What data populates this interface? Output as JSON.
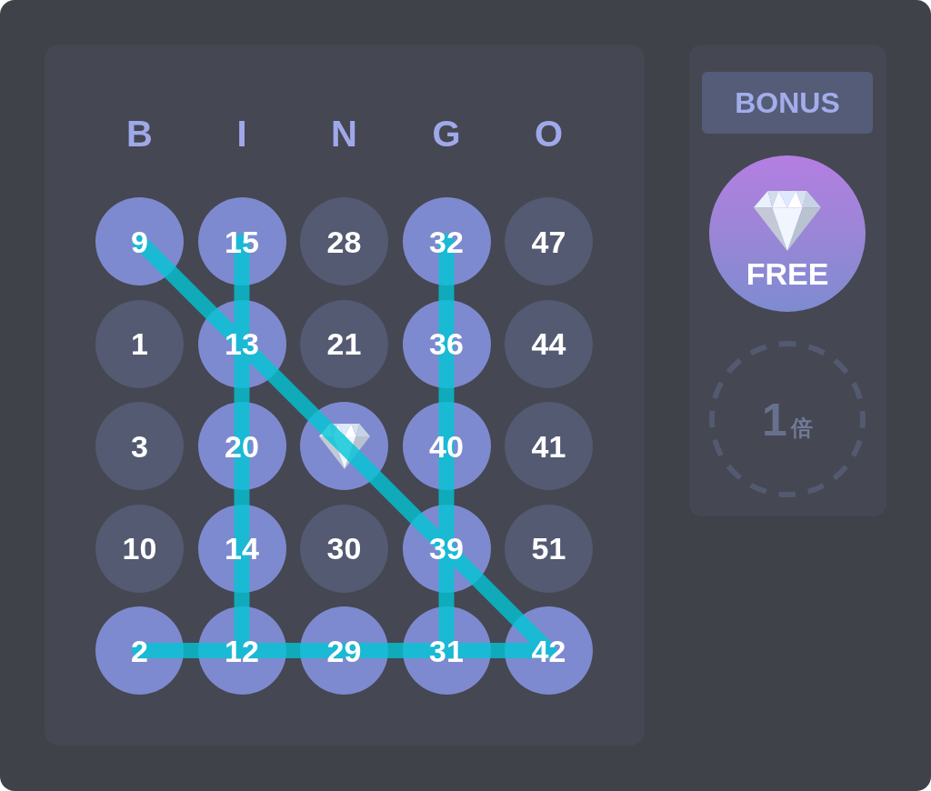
{
  "card": {
    "columns": [
      "B",
      "I",
      "N",
      "G",
      "O"
    ],
    "rows": [
      {
        "cells": [
          {
            "kind": "number",
            "number": "9",
            "marked": true
          },
          {
            "kind": "number",
            "number": "15",
            "marked": true
          },
          {
            "kind": "number",
            "number": "28",
            "marked": false
          },
          {
            "kind": "number",
            "number": "32",
            "marked": true
          },
          {
            "kind": "number",
            "number": "47",
            "marked": false
          }
        ]
      },
      {
        "cells": [
          {
            "kind": "number",
            "number": "1",
            "marked": false
          },
          {
            "kind": "number",
            "number": "13",
            "marked": true
          },
          {
            "kind": "number",
            "number": "21",
            "marked": false
          },
          {
            "kind": "number",
            "number": "36",
            "marked": true
          },
          {
            "kind": "number",
            "number": "44",
            "marked": false
          }
        ]
      },
      {
        "cells": [
          {
            "kind": "number",
            "number": "3",
            "marked": false
          },
          {
            "kind": "number",
            "number": "20",
            "marked": true
          },
          {
            "kind": "free",
            "marked": true
          },
          {
            "kind": "number",
            "number": "40",
            "marked": true
          },
          {
            "kind": "number",
            "number": "41",
            "marked": false
          }
        ]
      },
      {
        "cells": [
          {
            "kind": "number",
            "number": "10",
            "marked": false
          },
          {
            "kind": "number",
            "number": "14",
            "marked": true
          },
          {
            "kind": "number",
            "number": "30",
            "marked": false
          },
          {
            "kind": "number",
            "number": "39",
            "marked": true
          },
          {
            "kind": "number",
            "number": "51",
            "marked": false
          }
        ]
      },
      {
        "cells": [
          {
            "kind": "number",
            "number": "2",
            "marked": true
          },
          {
            "kind": "number",
            "number": "12",
            "marked": true
          },
          {
            "kind": "number",
            "number": "29",
            "marked": true
          },
          {
            "kind": "number",
            "number": "31",
            "marked": true
          },
          {
            "kind": "number",
            "number": "42",
            "marked": true
          }
        ]
      }
    ]
  },
  "bonus": {
    "title": "BONUS",
    "free_badge": {
      "label": "FREE"
    },
    "multiplier": {
      "value": "1",
      "unit": "倍"
    }
  }
}
